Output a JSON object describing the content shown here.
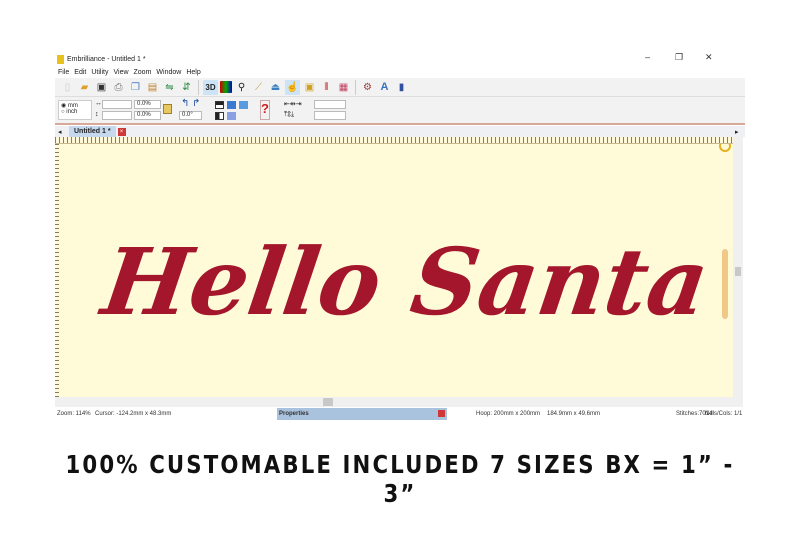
{
  "window": {
    "title": "Embrilliance - Untitled 1 *",
    "min": "–",
    "max": "❐",
    "close": "✕"
  },
  "menu": [
    "File",
    "Edit",
    "Utility",
    "View",
    "Zoom",
    "Window",
    "Help"
  ],
  "toolbar": {
    "icons": [
      "new-icon",
      "open-icon",
      "save-icon",
      "print-icon",
      "copy-icon",
      "paste-icon",
      "mirror-icon",
      "flip-icon",
      "3d-icon",
      "color-icon",
      "magnify-icon",
      "ruler-icon",
      "hoop-icon",
      "select-icon",
      "background-icon",
      "thread-icon",
      "pattern-icon",
      "lettering-icon",
      "font-icon",
      "stitch-icon"
    ],
    "label_3d": "3D",
    "label_a": "A"
  },
  "units": {
    "mm": "mm",
    "inch": "inch",
    "selected": "mm"
  },
  "fields": {
    "width": "",
    "height": "",
    "width_pct": "0.0%",
    "height_pct": "0.0%",
    "rotation": "0.0°"
  },
  "tab": {
    "label": "Untitled 1 *"
  },
  "design": {
    "text": "Hello Santa",
    "color": "#a3162b"
  },
  "status": {
    "zoom": "Zoom: 114%",
    "cursor": "Cursor: -124.2mm x 48.3mm",
    "properties": "Properties",
    "hoop": "Hoop: 200mm x 200mm",
    "size": "184.9mm x 49.6mm",
    "stitches": "Stitches:7014",
    "needles": "Ndls/Cols: 1/1"
  },
  "caption": "100% CUSTOMABLE INCLUDED 7 SIZES BX = 1” -  3”"
}
